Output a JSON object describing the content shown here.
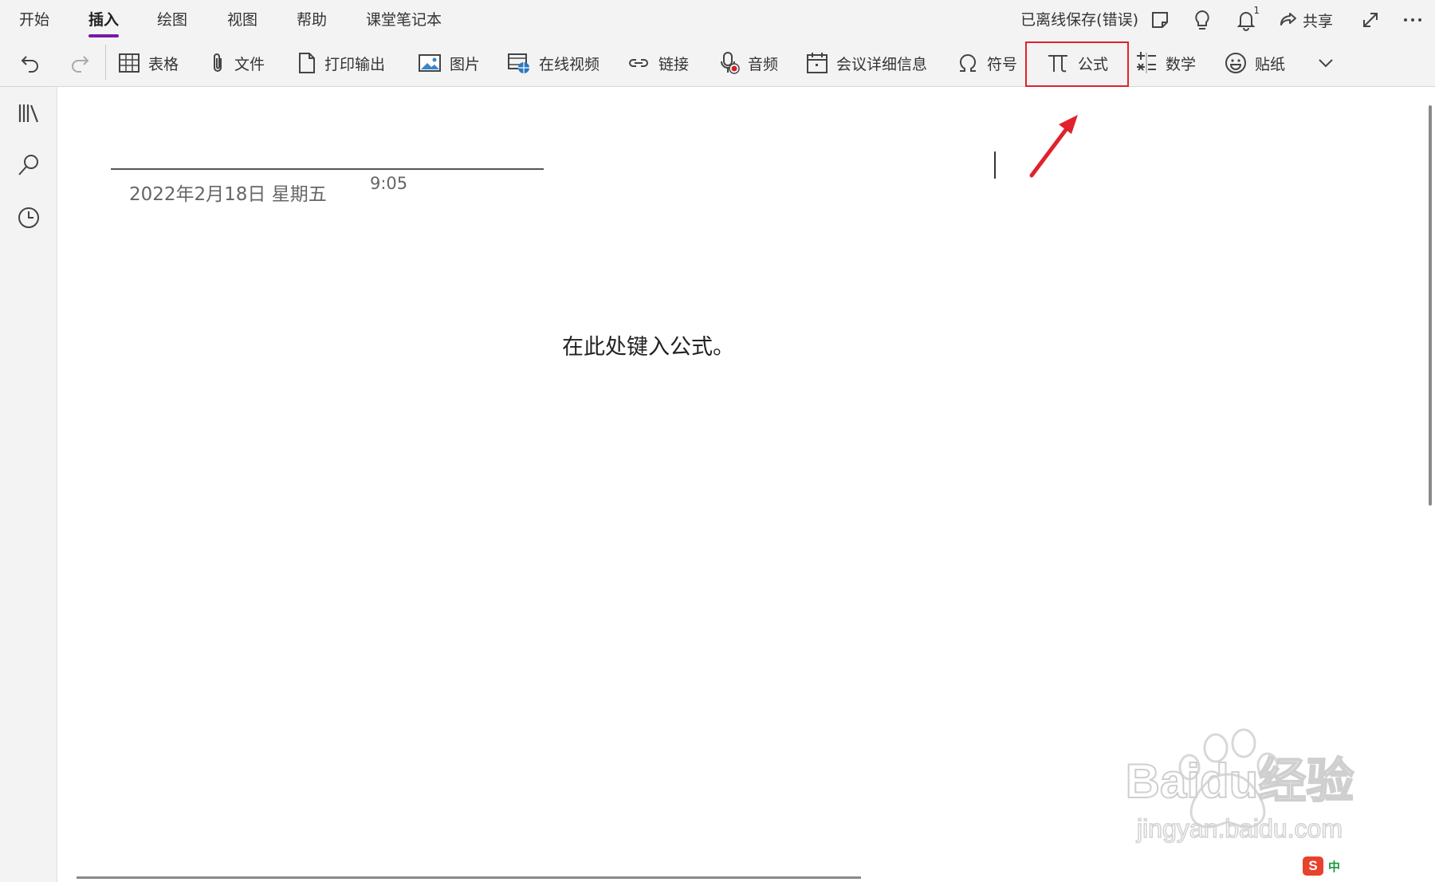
{
  "menu_tabs": [
    "开始",
    "插入",
    "绘图",
    "视图",
    "帮助",
    "课堂笔记本"
  ],
  "status": "已离线保存(错误)",
  "notification_count": "1",
  "share_label": "共享",
  "ribbon": {
    "table": "表格",
    "file": "文件",
    "printout": "打印输出",
    "picture": "图片",
    "online_video": "在线视频",
    "link": "链接",
    "audio": "音频",
    "meeting": "会议详细信息",
    "symbol": "符号",
    "equation": "公式",
    "math": "数学",
    "sticker": "贴纸"
  },
  "page": {
    "date": "2022年2月18日 星期五",
    "time": "9:05",
    "formula_placeholder": "在此处键入公式。"
  },
  "ime": {
    "logo": "S",
    "mode": "中"
  },
  "watermark": {
    "brand": "Baidu经验",
    "url": "jingyan.baidu.com"
  },
  "colors": {
    "accent": "#7719aa",
    "highlight": "#e0222c",
    "arrow": "#e0222c"
  }
}
